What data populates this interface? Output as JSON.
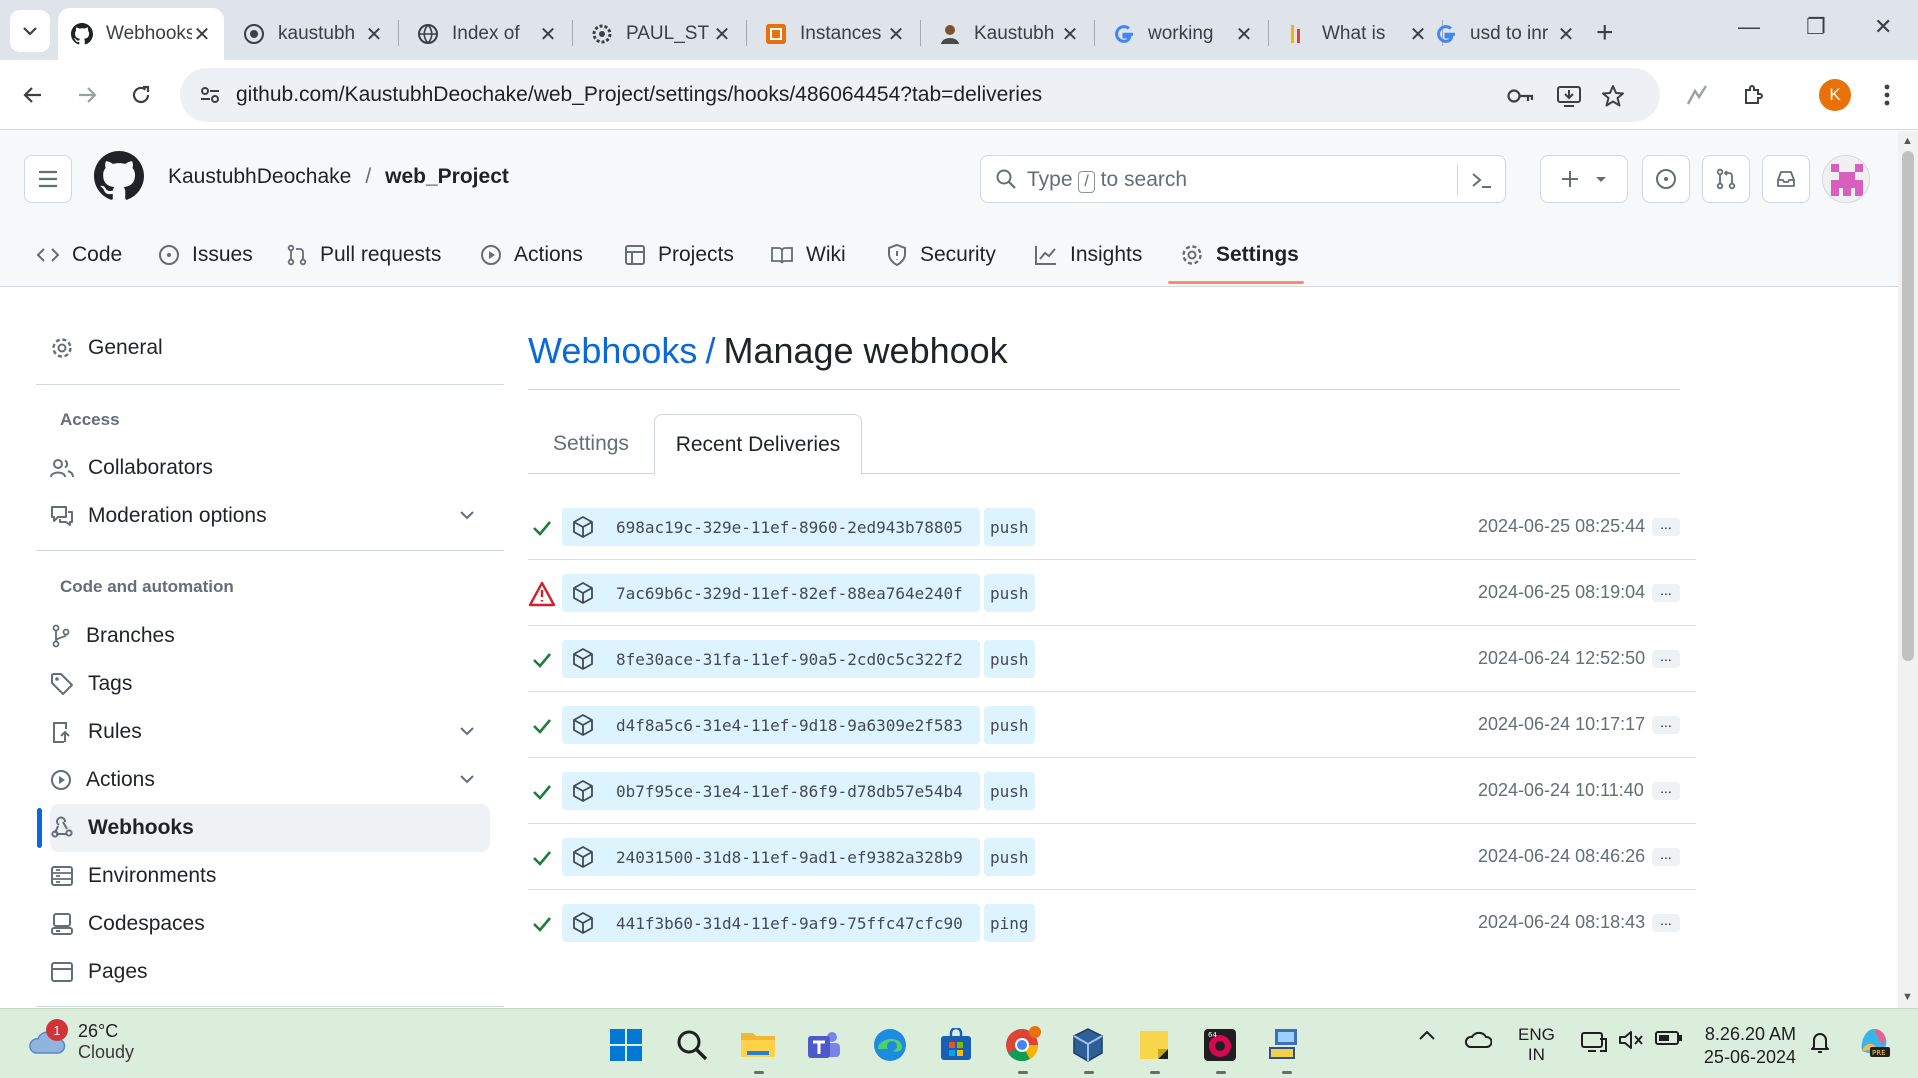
{
  "browser": {
    "tabs": [
      {
        "title": "Webhooks",
        "icon": "github-icon",
        "active": true
      },
      {
        "title": "kaustubh",
        "icon": "docker-icon",
        "active": false
      },
      {
        "title": "Index of",
        "icon": "globe-icon",
        "active": false
      },
      {
        "title": "PAUL_ST",
        "icon": "settings-gear-icon",
        "active": false
      },
      {
        "title": "Instances",
        "icon": "aws-icon",
        "active": false
      },
      {
        "title": "Kaustubh",
        "icon": "person-icon",
        "active": false
      },
      {
        "title": "working",
        "icon": "google-icon",
        "active": false
      },
      {
        "title": "What is",
        "icon": "kubernetes-icon",
        "active": false
      },
      {
        "title": "usd to inr",
        "icon": "google-icon",
        "active": false
      }
    ],
    "url": "github.com/KaustubhDeochake/web_Project/settings/hooks/486064454?tab=deliveries",
    "profile_initial": "K"
  },
  "repo": {
    "owner": "KaustubhDeochake",
    "separator": "/",
    "name": "web_Project"
  },
  "search": {
    "prefix": "Type",
    "key": "/",
    "suffix": "to search"
  },
  "nav": {
    "items": [
      "Code",
      "Issues",
      "Pull requests",
      "Actions",
      "Projects",
      "Wiki",
      "Security",
      "Insights",
      "Settings"
    ],
    "selected": "Settings"
  },
  "sidebar": {
    "general": "General",
    "access_heading": "Access",
    "collaborators": "Collaborators",
    "moderation": "Moderation options",
    "code_heading": "Code and automation",
    "branches": "Branches",
    "tags": "Tags",
    "rules": "Rules",
    "actions": "Actions",
    "webhooks": "Webhooks",
    "environments": "Environments",
    "codespaces": "Codespaces",
    "pages": "Pages"
  },
  "page": {
    "breadcrumb_link": "Webhooks",
    "breadcrumb_sep": "/",
    "title": "Manage webhook",
    "tab_settings": "Settings",
    "tab_recent": "Recent Deliveries"
  },
  "deliveries": [
    {
      "status": "success",
      "guid": "698ac19c-329e-11ef-8960-2ed943b78805",
      "event": "push",
      "time": "2024-06-25 08:25:44"
    },
    {
      "status": "failed",
      "guid": "7ac69b6c-329d-11ef-82ef-88ea764e240f",
      "event": "push",
      "time": "2024-06-25 08:19:04"
    },
    {
      "status": "success",
      "guid": "8fe30ace-31fa-11ef-90a5-2cd0c5c322f2",
      "event": "push",
      "time": "2024-06-24 12:52:50"
    },
    {
      "status": "success",
      "guid": "d4f8a5c6-31e4-11ef-9d18-9a6309e2f583",
      "event": "push",
      "time": "2024-06-24 10:17:17"
    },
    {
      "status": "success",
      "guid": "0b7f95ce-31e4-11ef-86f9-d78db57e54b4",
      "event": "push",
      "time": "2024-06-24 10:11:40"
    },
    {
      "status": "success",
      "guid": "24031500-31d8-11ef-9ad1-ef9382a328b9",
      "event": "push",
      "time": "2024-06-24 08:46:26"
    },
    {
      "status": "success",
      "guid": "441f3b60-31d4-11ef-9af9-75ffc47cfc90",
      "event": "ping",
      "time": "2024-06-24 08:18:43"
    }
  ],
  "more_label": "...",
  "taskbar": {
    "weather_temp": "26°C",
    "weather_desc": "Cloudy",
    "weather_badge": "1",
    "lang_line1": "ENG",
    "lang_line2": "IN",
    "time": "8.26.20 AM",
    "date": "25-06-2024"
  },
  "colors": {
    "link": "#0969da",
    "success": "#1a7f37",
    "danger": "#cf222e",
    "nav_underline": "#fd8c73",
    "pill_bg": "#ddf4ff"
  }
}
